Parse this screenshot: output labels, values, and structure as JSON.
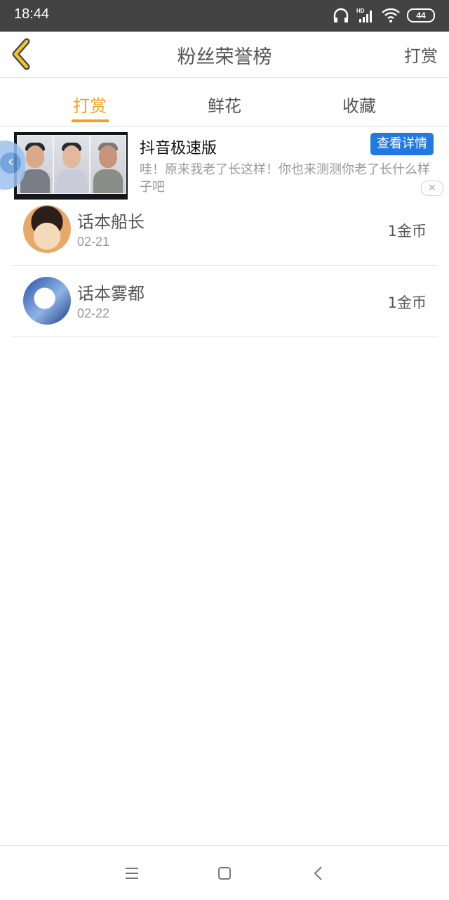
{
  "status_bar": {
    "time": "18:44",
    "battery": "44",
    "network_label": "HD"
  },
  "header": {
    "title": "粉丝荣誉榜",
    "action": "打赏"
  },
  "tabs": [
    {
      "label": "打赏",
      "active": true
    },
    {
      "label": "鲜花",
      "active": false
    },
    {
      "label": "收藏",
      "active": false
    }
  ],
  "ad": {
    "title": "抖音极速版",
    "cta": "查看详情",
    "description": "哇！原来我老了长这样！你也来测测你老了长什么样子吧"
  },
  "list": [
    {
      "name": "话本船长",
      "date": "02-21",
      "amount": "1金币"
    },
    {
      "name": "话本雾都",
      "date": "02-22",
      "amount": "1金币"
    }
  ],
  "colors": {
    "accent": "#f0a020",
    "status_bar": "#434343",
    "cta_blue": "#2279e0",
    "text": "#555555",
    "muted": "#999999"
  },
  "icons": [
    "back-chevron-icon",
    "headset-icon",
    "signal-icon",
    "wifi-icon",
    "battery-icon",
    "menu-icon",
    "home-icon",
    "back-nav-icon",
    "close-icon"
  ]
}
